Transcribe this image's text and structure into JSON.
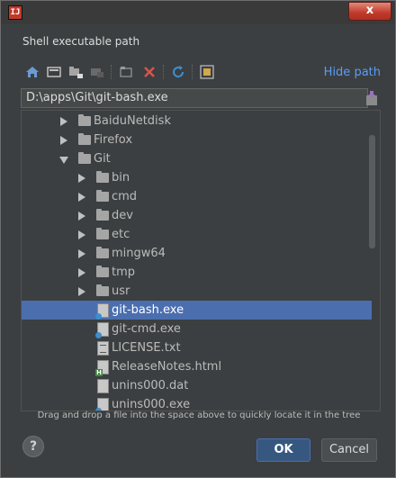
{
  "window": {
    "close_label": "x"
  },
  "dialog": {
    "title": "Shell executable path"
  },
  "toolbar": {
    "hide_path_label": "Hide path",
    "icons": [
      "home-icon",
      "desktop-icon",
      "new-folder-icon",
      "module-icon",
      "refresh-icon",
      "delete-icon",
      "sync-icon",
      "show-hidden-icon"
    ]
  },
  "path_field": {
    "value": "D:\\apps\\Git\\git-bash.exe"
  },
  "tree": {
    "rows": [
      {
        "label": "BaiduNetdisk",
        "type": "folder",
        "expanded": false,
        "depth": 1
      },
      {
        "label": "Firefox",
        "type": "folder",
        "expanded": false,
        "depth": 1
      },
      {
        "label": "Git",
        "type": "folder",
        "expanded": true,
        "depth": 1
      },
      {
        "label": "bin",
        "type": "folder",
        "expanded": false,
        "depth": 2
      },
      {
        "label": "cmd",
        "type": "folder",
        "expanded": false,
        "depth": 2
      },
      {
        "label": "dev",
        "type": "folder",
        "expanded": false,
        "depth": 2
      },
      {
        "label": "etc",
        "type": "folder",
        "expanded": false,
        "depth": 2
      },
      {
        "label": "mingw64",
        "type": "folder",
        "expanded": false,
        "depth": 2
      },
      {
        "label": "tmp",
        "type": "folder",
        "expanded": false,
        "depth": 2
      },
      {
        "label": "usr",
        "type": "folder",
        "expanded": false,
        "depth": 2
      },
      {
        "label": "git-bash.exe",
        "type": "exe",
        "selected": true,
        "depth": 2
      },
      {
        "label": "git-cmd.exe",
        "type": "exe",
        "depth": 2
      },
      {
        "label": "LICENSE.txt",
        "type": "txt",
        "depth": 2
      },
      {
        "label": "ReleaseNotes.html",
        "type": "html",
        "depth": 2
      },
      {
        "label": "unins000.dat",
        "type": "dat",
        "depth": 2
      },
      {
        "label": "unins000.exe",
        "type": "exe",
        "depth": 2
      }
    ]
  },
  "hint_text": "Drag and drop a file into the space above to quickly locate it in the tree",
  "footer": {
    "help_label": "?",
    "ok_label": "OK",
    "cancel_label": "Cancel"
  },
  "colors": {
    "background": "#3c3f41",
    "selection": "#4b6eaf",
    "link": "#589df6",
    "delete_red": "#d9534f",
    "refresh_blue": "#3a8fd0"
  }
}
